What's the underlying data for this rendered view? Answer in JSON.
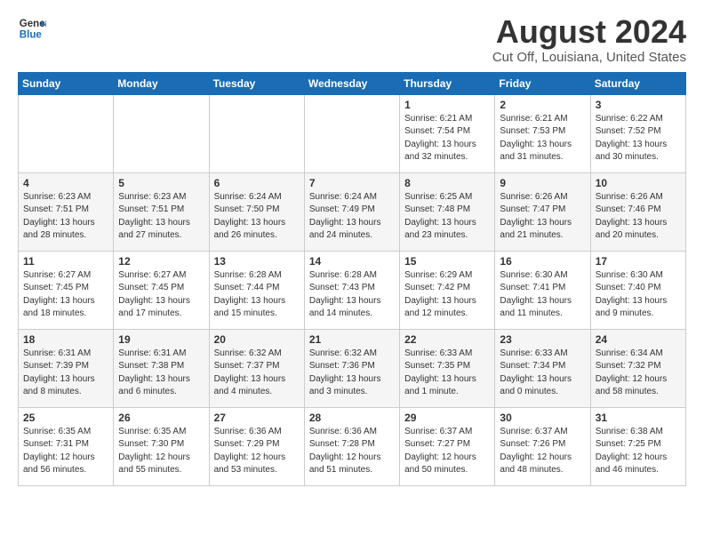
{
  "header": {
    "logo_line1": "General",
    "logo_line2": "Blue",
    "title": "August 2024",
    "subtitle": "Cut Off, Louisiana, United States"
  },
  "weekdays": [
    "Sunday",
    "Monday",
    "Tuesday",
    "Wednesday",
    "Thursday",
    "Friday",
    "Saturday"
  ],
  "weeks": [
    [
      {
        "day": "",
        "info": ""
      },
      {
        "day": "",
        "info": ""
      },
      {
        "day": "",
        "info": ""
      },
      {
        "day": "",
        "info": ""
      },
      {
        "day": "1",
        "info": "Sunrise: 6:21 AM\nSunset: 7:54 PM\nDaylight: 13 hours\nand 32 minutes."
      },
      {
        "day": "2",
        "info": "Sunrise: 6:21 AM\nSunset: 7:53 PM\nDaylight: 13 hours\nand 31 minutes."
      },
      {
        "day": "3",
        "info": "Sunrise: 6:22 AM\nSunset: 7:52 PM\nDaylight: 13 hours\nand 30 minutes."
      }
    ],
    [
      {
        "day": "4",
        "info": "Sunrise: 6:23 AM\nSunset: 7:51 PM\nDaylight: 13 hours\nand 28 minutes."
      },
      {
        "day": "5",
        "info": "Sunrise: 6:23 AM\nSunset: 7:51 PM\nDaylight: 13 hours\nand 27 minutes."
      },
      {
        "day": "6",
        "info": "Sunrise: 6:24 AM\nSunset: 7:50 PM\nDaylight: 13 hours\nand 26 minutes."
      },
      {
        "day": "7",
        "info": "Sunrise: 6:24 AM\nSunset: 7:49 PM\nDaylight: 13 hours\nand 24 minutes."
      },
      {
        "day": "8",
        "info": "Sunrise: 6:25 AM\nSunset: 7:48 PM\nDaylight: 13 hours\nand 23 minutes."
      },
      {
        "day": "9",
        "info": "Sunrise: 6:26 AM\nSunset: 7:47 PM\nDaylight: 13 hours\nand 21 minutes."
      },
      {
        "day": "10",
        "info": "Sunrise: 6:26 AM\nSunset: 7:46 PM\nDaylight: 13 hours\nand 20 minutes."
      }
    ],
    [
      {
        "day": "11",
        "info": "Sunrise: 6:27 AM\nSunset: 7:45 PM\nDaylight: 13 hours\nand 18 minutes."
      },
      {
        "day": "12",
        "info": "Sunrise: 6:27 AM\nSunset: 7:45 PM\nDaylight: 13 hours\nand 17 minutes."
      },
      {
        "day": "13",
        "info": "Sunrise: 6:28 AM\nSunset: 7:44 PM\nDaylight: 13 hours\nand 15 minutes."
      },
      {
        "day": "14",
        "info": "Sunrise: 6:28 AM\nSunset: 7:43 PM\nDaylight: 13 hours\nand 14 minutes."
      },
      {
        "day": "15",
        "info": "Sunrise: 6:29 AM\nSunset: 7:42 PM\nDaylight: 13 hours\nand 12 minutes."
      },
      {
        "day": "16",
        "info": "Sunrise: 6:30 AM\nSunset: 7:41 PM\nDaylight: 13 hours\nand 11 minutes."
      },
      {
        "day": "17",
        "info": "Sunrise: 6:30 AM\nSunset: 7:40 PM\nDaylight: 13 hours\nand 9 minutes."
      }
    ],
    [
      {
        "day": "18",
        "info": "Sunrise: 6:31 AM\nSunset: 7:39 PM\nDaylight: 13 hours\nand 8 minutes."
      },
      {
        "day": "19",
        "info": "Sunrise: 6:31 AM\nSunset: 7:38 PM\nDaylight: 13 hours\nand 6 minutes."
      },
      {
        "day": "20",
        "info": "Sunrise: 6:32 AM\nSunset: 7:37 PM\nDaylight: 13 hours\nand 4 minutes."
      },
      {
        "day": "21",
        "info": "Sunrise: 6:32 AM\nSunset: 7:36 PM\nDaylight: 13 hours\nand 3 minutes."
      },
      {
        "day": "22",
        "info": "Sunrise: 6:33 AM\nSunset: 7:35 PM\nDaylight: 13 hours\nand 1 minute."
      },
      {
        "day": "23",
        "info": "Sunrise: 6:33 AM\nSunset: 7:34 PM\nDaylight: 13 hours\nand 0 minutes."
      },
      {
        "day": "24",
        "info": "Sunrise: 6:34 AM\nSunset: 7:32 PM\nDaylight: 12 hours\nand 58 minutes."
      }
    ],
    [
      {
        "day": "25",
        "info": "Sunrise: 6:35 AM\nSunset: 7:31 PM\nDaylight: 12 hours\nand 56 minutes."
      },
      {
        "day": "26",
        "info": "Sunrise: 6:35 AM\nSunset: 7:30 PM\nDaylight: 12 hours\nand 55 minutes."
      },
      {
        "day": "27",
        "info": "Sunrise: 6:36 AM\nSunset: 7:29 PM\nDaylight: 12 hours\nand 53 minutes."
      },
      {
        "day": "28",
        "info": "Sunrise: 6:36 AM\nSunset: 7:28 PM\nDaylight: 12 hours\nand 51 minutes."
      },
      {
        "day": "29",
        "info": "Sunrise: 6:37 AM\nSunset: 7:27 PM\nDaylight: 12 hours\nand 50 minutes."
      },
      {
        "day": "30",
        "info": "Sunrise: 6:37 AM\nSunset: 7:26 PM\nDaylight: 12 hours\nand 48 minutes."
      },
      {
        "day": "31",
        "info": "Sunrise: 6:38 AM\nSunset: 7:25 PM\nDaylight: 12 hours\nand 46 minutes."
      }
    ]
  ]
}
